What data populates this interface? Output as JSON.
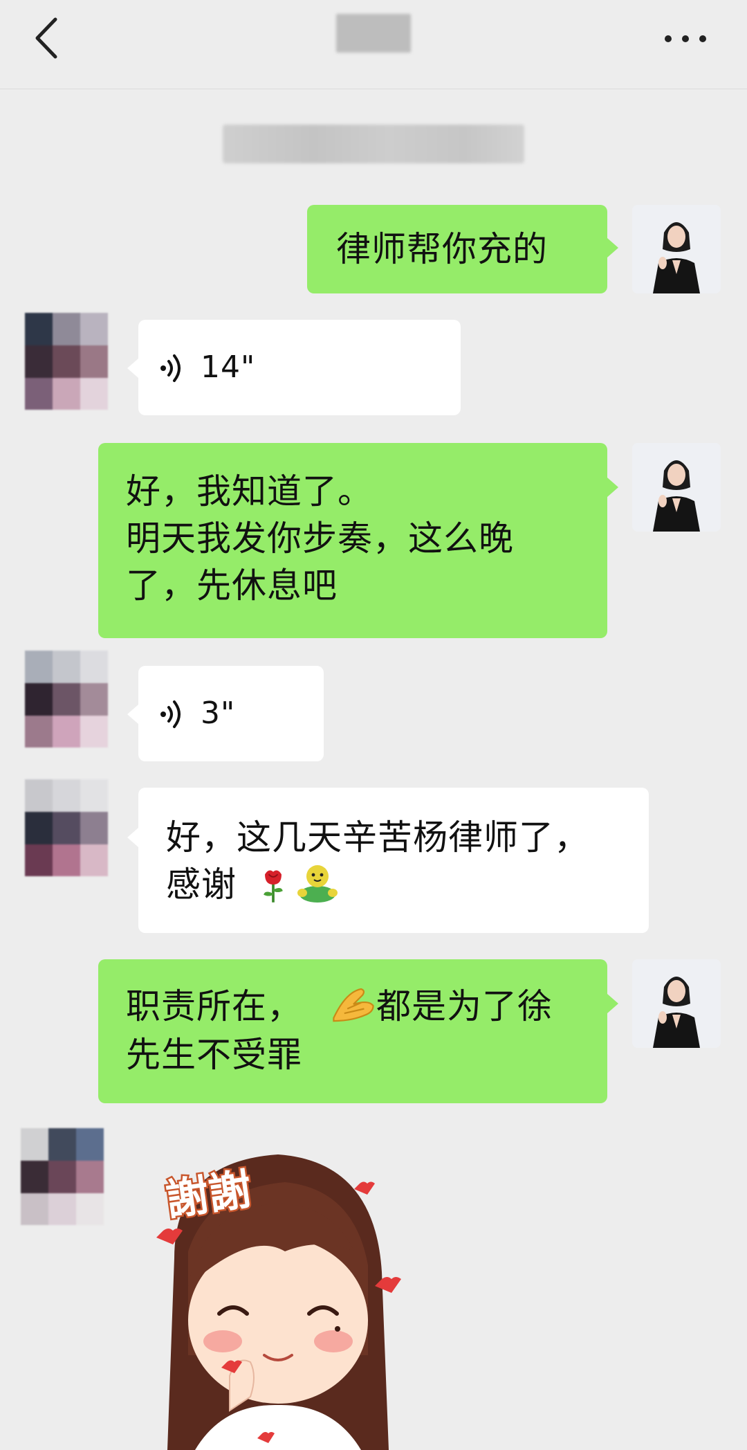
{
  "header": {
    "back_icon": "chevron-left-icon",
    "more_icon": "more-dots-icon",
    "title_blurred": true
  },
  "timestamp_blurred": true,
  "messages": [
    {
      "id": 1,
      "side": "right",
      "type": "text",
      "lines": [
        "律师帮你充的"
      ]
    },
    {
      "id": 2,
      "side": "left",
      "type": "voice",
      "duration": "14\""
    },
    {
      "id": 3,
      "side": "right",
      "type": "text",
      "lines": [
        "好，我知道了。",
        "明天我发你步奏，这么晚",
        "了，先休息吧"
      ]
    },
    {
      "id": 4,
      "side": "left",
      "type": "voice",
      "duration": "3\""
    },
    {
      "id": 5,
      "side": "left",
      "type": "text",
      "lines": [
        "好，这几天辛苦杨律师了，",
        "感谢"
      ],
      "emoji": [
        "rose-emoji",
        "hug-emoji"
      ]
    },
    {
      "id": 6,
      "side": "right",
      "type": "text",
      "lines_a": "职责所在，",
      "lines_b": "都是为了徐",
      "line2": "先生不受罪",
      "emoji": [
        "hands-together-emoji"
      ]
    },
    {
      "id": 7,
      "side": "left",
      "type": "sticker",
      "sticker_text": "謝謝"
    }
  ],
  "colors": {
    "background": "#ededed",
    "self_bubble": "#95ec69",
    "other_bubble": "#ffffff",
    "text": "#111111"
  }
}
